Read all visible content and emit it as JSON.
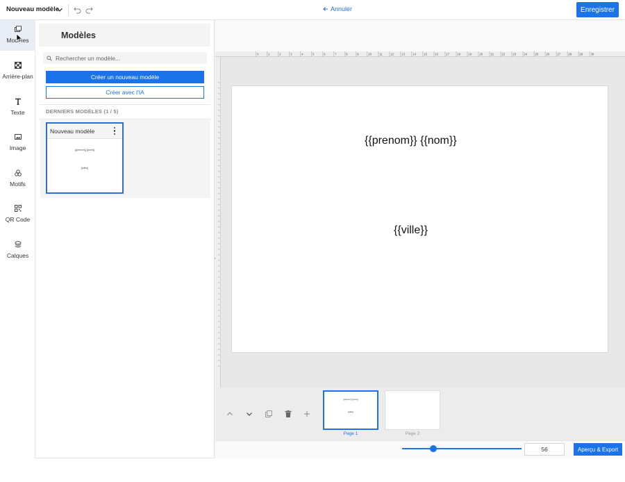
{
  "topbar": {
    "doc_title": "Nouveau modèle",
    "cancel_label": "Annuler",
    "save_label": "Enregistrer"
  },
  "rail": {
    "items": [
      {
        "label": "Modèles",
        "icon": "templates-icon",
        "active": true
      },
      {
        "label": "Arrière-plan",
        "icon": "background-icon",
        "active": false
      },
      {
        "label": "Texte",
        "icon": "text-icon",
        "active": false
      },
      {
        "label": "Image",
        "icon": "image-icon",
        "active": false
      },
      {
        "label": "Motifs",
        "icon": "shapes-icon",
        "active": false
      },
      {
        "label": "QR Code",
        "icon": "qr-code-icon",
        "active": false
      },
      {
        "label": "Calques",
        "icon": "layers-icon",
        "active": false
      }
    ]
  },
  "panel": {
    "title": "Modèles",
    "search_placeholder": "Rechercher un modèle...",
    "create_new_label": "Créer un nouveau modèle",
    "create_ai_label": "Créer avec l'IA",
    "recent_label": "DERNIERS MODÈLES (1 / 5)",
    "recent_models": [
      {
        "name": "Nouveau modèle",
        "preview_line1": "{{prenom}} {{nom}}",
        "preview_line2": "{{ville}}"
      }
    ]
  },
  "ruler": {
    "marks": [
      "0",
      "1",
      "2",
      "3",
      "4",
      "5",
      "6",
      "7",
      "8",
      "9",
      "10",
      "11",
      "12",
      "13",
      "14",
      "15",
      "16",
      "17",
      "18",
      "19",
      "20",
      "21",
      "22",
      "23",
      "24",
      "25",
      "26",
      "27",
      "28",
      "29",
      "30"
    ]
  },
  "canvas": {
    "line1": "{{prenom}} {{nom}}",
    "line2": "{{ville}}"
  },
  "pages": [
    {
      "label": "Page 1",
      "selected": true
    },
    {
      "label": "Page 2",
      "selected": false
    }
  ],
  "zoom": {
    "value": "56",
    "slider_fraction": 0.26
  },
  "export_label": "Aperçu & Export",
  "colors": {
    "accent": "#1a73e8",
    "active_rail": "#e9eef6"
  }
}
